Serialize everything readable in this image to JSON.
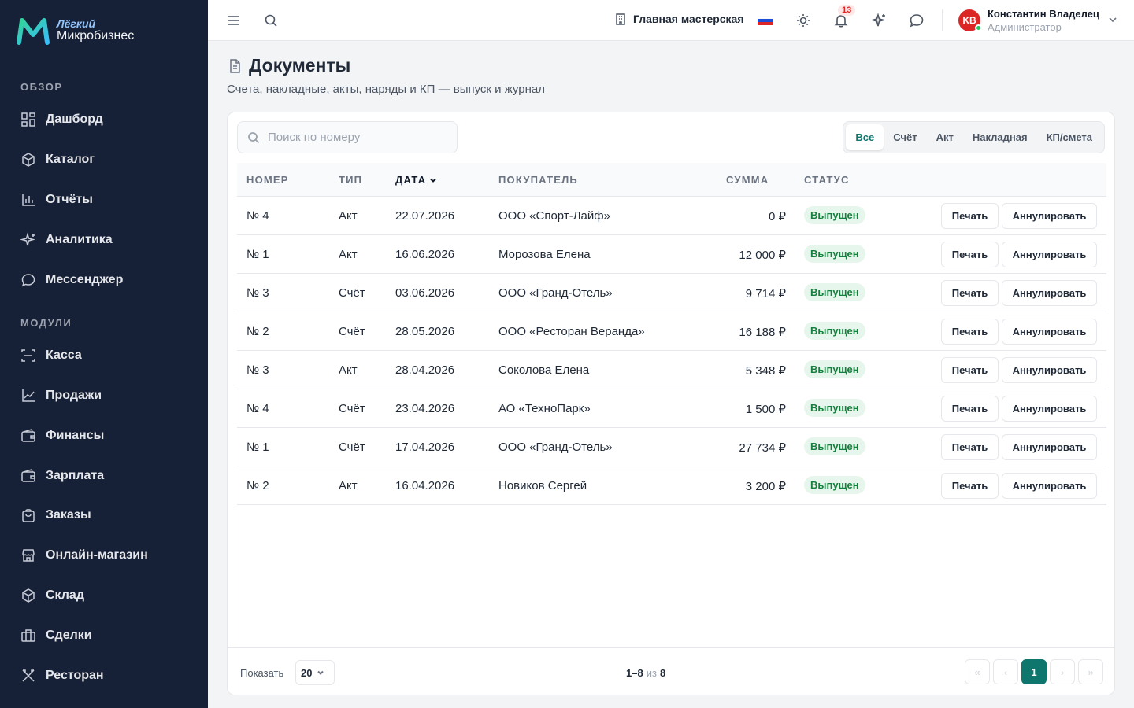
{
  "brand": {
    "line1": "Лёгкий",
    "line2": "Микробизнес"
  },
  "sidebar": {
    "section_overview": "ОБЗОР",
    "section_modules": "МОДУЛИ",
    "items": [
      {
        "label": "Дашборд",
        "icon": "dashboard-icon"
      },
      {
        "label": "Каталог",
        "icon": "catalog-icon"
      },
      {
        "label": "Отчёты",
        "icon": "reports-icon"
      },
      {
        "label": "Аналитика",
        "icon": "analytics-icon"
      },
      {
        "label": "Мессенджер",
        "icon": "messenger-icon"
      },
      {
        "label": "Касса",
        "icon": "cashier-icon"
      },
      {
        "label": "Продажи",
        "icon": "sales-icon"
      },
      {
        "label": "Финансы",
        "icon": "finance-icon"
      },
      {
        "label": "Зарплата",
        "icon": "salary-icon"
      },
      {
        "label": "Заказы",
        "icon": "orders-icon"
      },
      {
        "label": "Онлайн-магазин",
        "icon": "store-icon"
      },
      {
        "label": "Склад",
        "icon": "warehouse-icon"
      },
      {
        "label": "Сделки",
        "icon": "deals-icon"
      },
      {
        "label": "Ресторан",
        "icon": "restaurant-icon"
      }
    ]
  },
  "topbar": {
    "workspace": "Главная мастерская",
    "notifications_count": "13",
    "user": {
      "initials": "KB",
      "name": "Константин Владелец",
      "role": "Администратор"
    }
  },
  "page": {
    "title": "Документы",
    "subtitle": "Счета, накладные, акты, наряды и КП — выпуск и журнал"
  },
  "search": {
    "placeholder": "Поиск по номеру"
  },
  "filters": [
    "Все",
    "Счёт",
    "Акт",
    "Накладная",
    "КП/смета"
  ],
  "active_filter": "Все",
  "table": {
    "columns": {
      "number": "НОМЕР",
      "type": "ТИП",
      "date": "ДАТА",
      "buyer": "ПОКУПАТЕЛЬ",
      "sum": "СУММА",
      "status": "СТАТУС"
    },
    "print_label": "Печать",
    "cancel_label": "Аннулировать",
    "rows": [
      {
        "number": "№ 4",
        "type": "Акт",
        "date": "22.07.2026",
        "buyer": "ООО «Спорт-Лайф»",
        "sum": "0 ₽",
        "status": "Выпущен"
      },
      {
        "number": "№ 1",
        "type": "Акт",
        "date": "16.06.2026",
        "buyer": "Морозова Елена",
        "sum": "12 000 ₽",
        "status": "Выпущен"
      },
      {
        "number": "№ 3",
        "type": "Счёт",
        "date": "03.06.2026",
        "buyer": "ООО «Гранд-Отель»",
        "sum": "9 714 ₽",
        "status": "Выпущен"
      },
      {
        "number": "№ 2",
        "type": "Счёт",
        "date": "28.05.2026",
        "buyer": "ООО «Ресторан Веранда»",
        "sum": "16 188 ₽",
        "status": "Выпущен"
      },
      {
        "number": "№ 3",
        "type": "Акт",
        "date": "28.04.2026",
        "buyer": "Соколова Елена",
        "sum": "5 348 ₽",
        "status": "Выпущен"
      },
      {
        "number": "№ 4",
        "type": "Счёт",
        "date": "23.04.2026",
        "buyer": "АО «ТехноПарк»",
        "sum": "1 500 ₽",
        "status": "Выпущен"
      },
      {
        "number": "№ 1",
        "type": "Счёт",
        "date": "17.04.2026",
        "buyer": "ООО «Гранд-Отель»",
        "sum": "27 734 ₽",
        "status": "Выпущен"
      },
      {
        "number": "№ 2",
        "type": "Акт",
        "date": "16.04.2026",
        "buyer": "Новиков Сергей",
        "sum": "3 200 ₽",
        "status": "Выпущен"
      }
    ]
  },
  "footer": {
    "show_label": "Показать",
    "page_size": "20",
    "range": "1–8",
    "of": "из",
    "total": "8",
    "current_page": "1"
  },
  "colors": {
    "sidebar_bg": "#162036",
    "accent": "#0f766e",
    "status_green": "#15803d",
    "badge_red": "#dc2626"
  }
}
